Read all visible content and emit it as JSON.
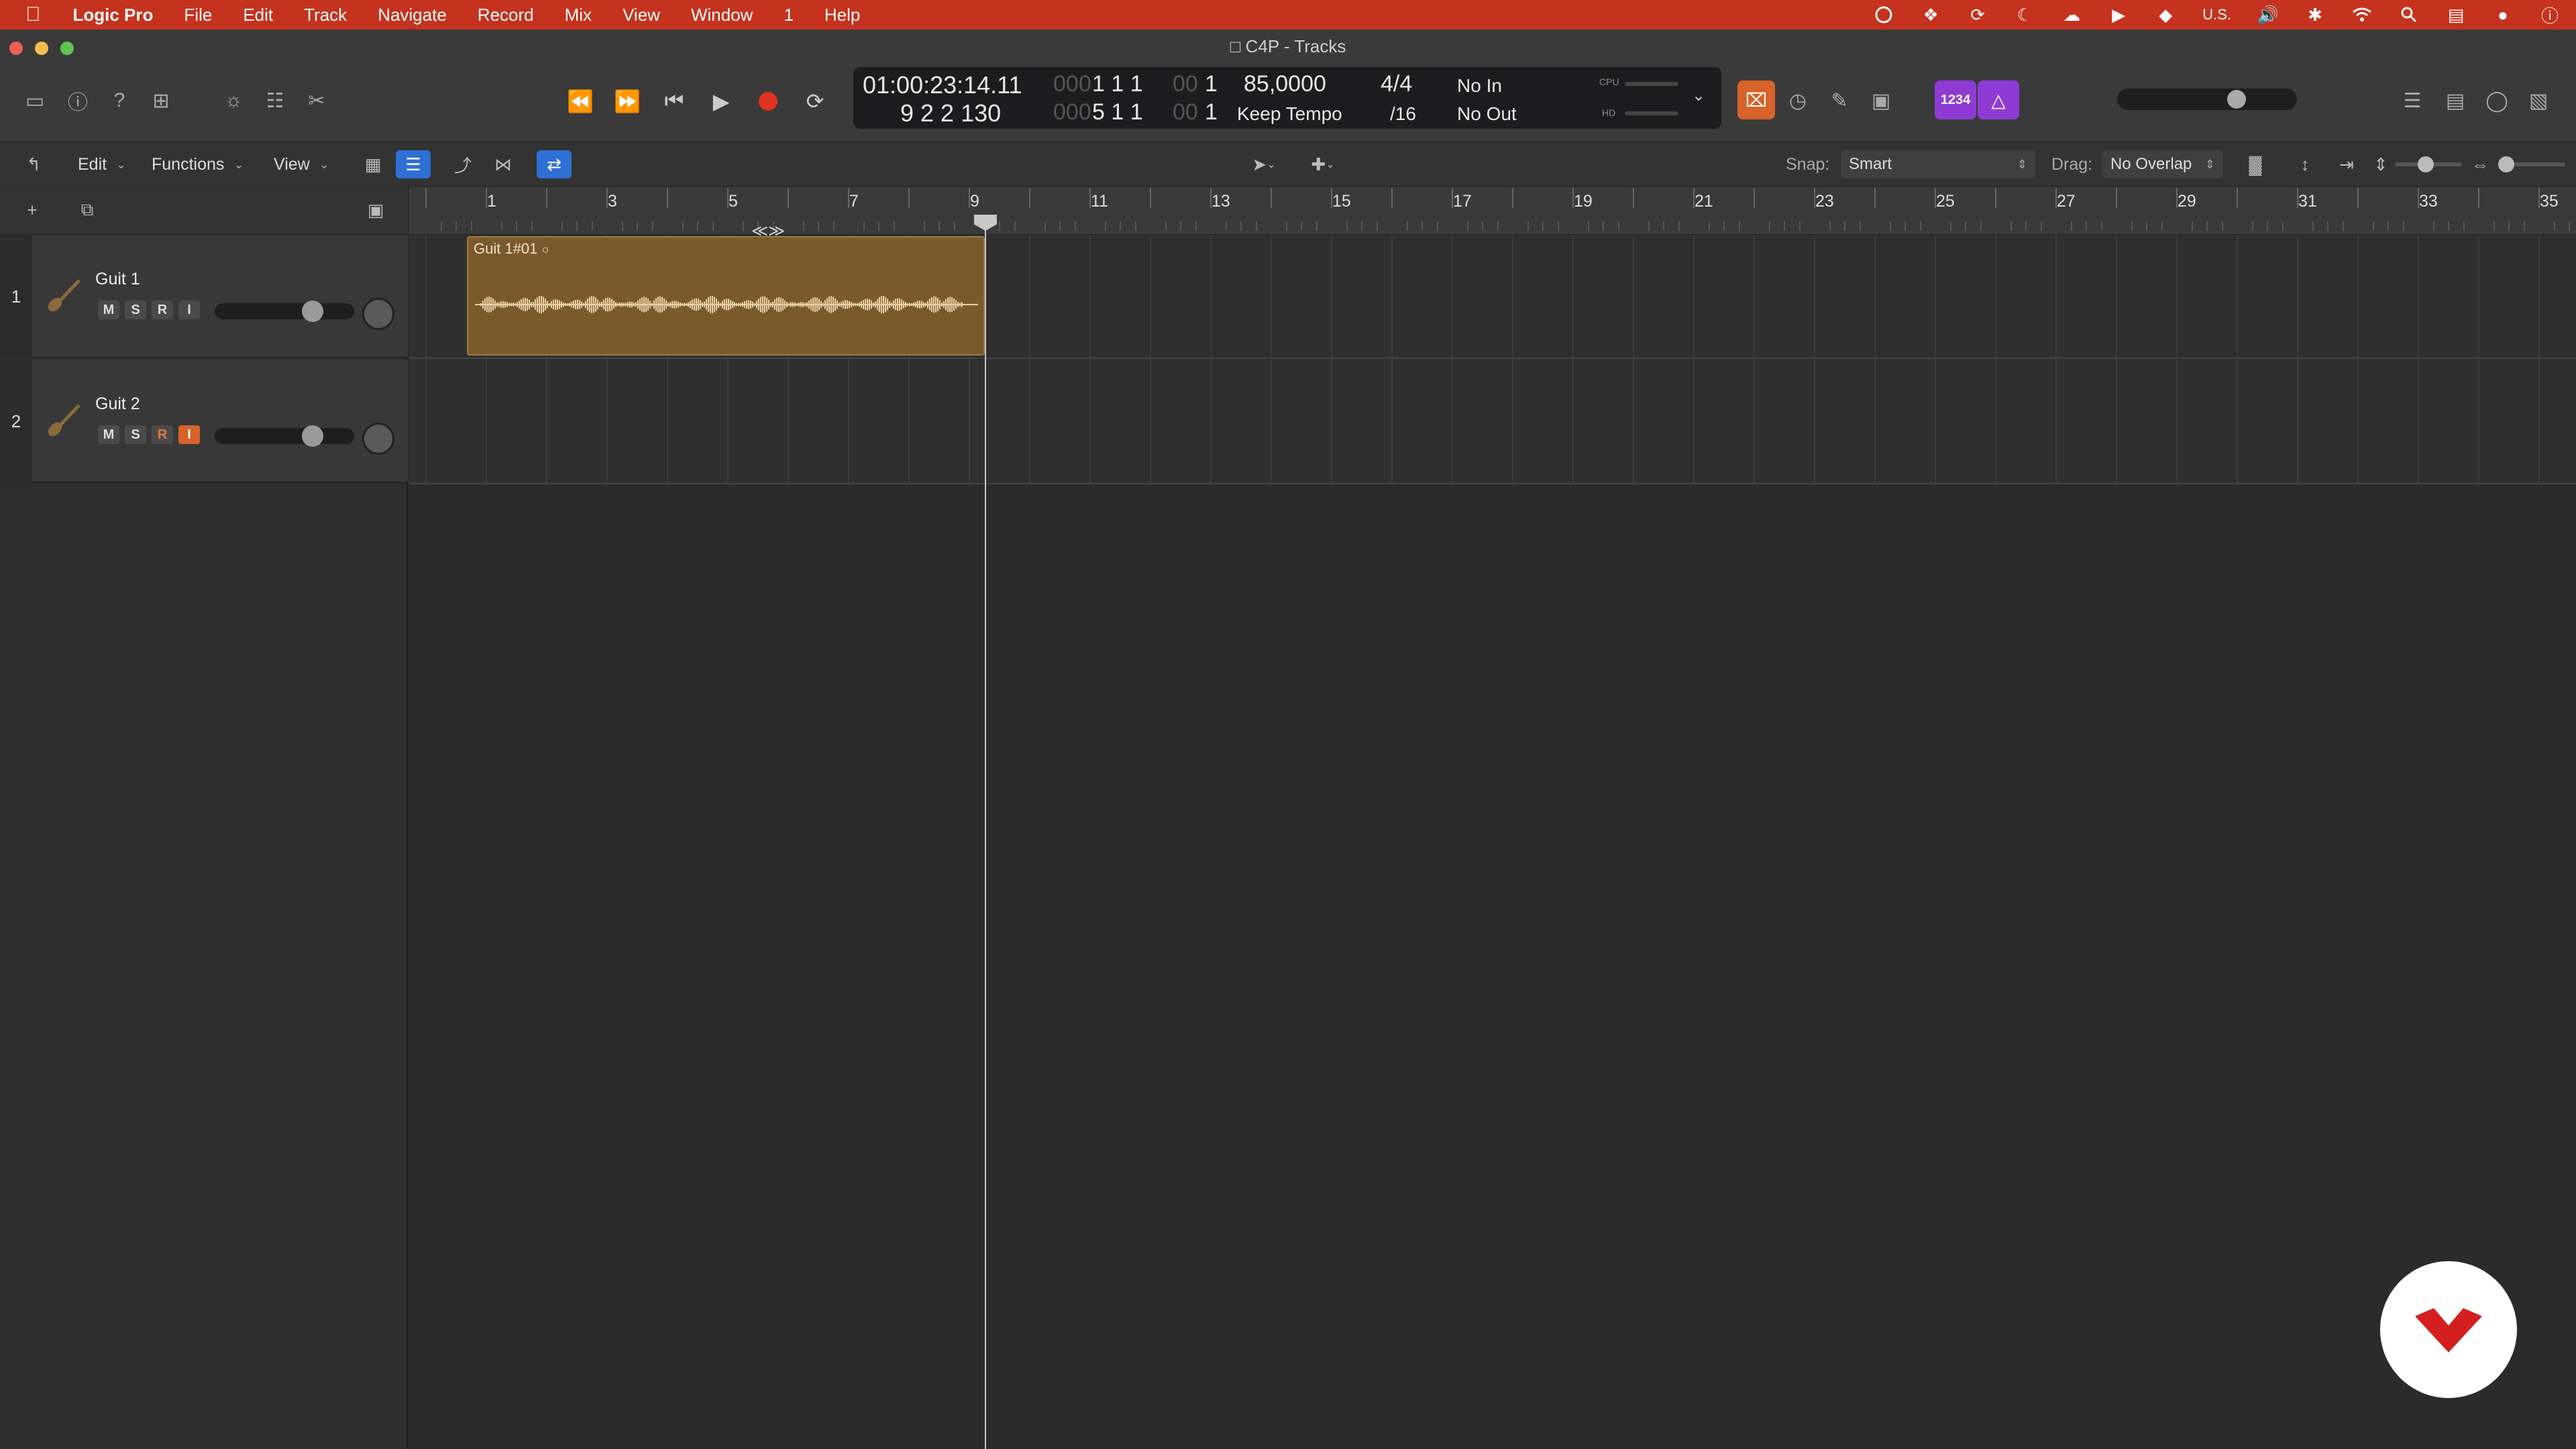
{
  "menubar": {
    "app_name": "Logic Pro",
    "items": [
      "File",
      "Edit",
      "Track",
      "Navigate",
      "Record",
      "Mix",
      "View",
      "Window",
      "1",
      "Help"
    ],
    "input_source": "U.S."
  },
  "window": {
    "title": "C4P - Tracks"
  },
  "lcd": {
    "time": "01:00:23:14.11",
    "position_bars": "9  2  2  130",
    "position_dim_top": "000",
    "position_top": "1  1  1",
    "position_top_dim2": "00",
    "position_top_tail": "1",
    "locator_dim": "000",
    "locator": "5  1  1",
    "locator_dim2": "00",
    "locator_tail": "1",
    "tempo": "85,0000",
    "tempo_mode": "Keep Tempo",
    "signature": "4/4",
    "division": "/16",
    "in": "No In",
    "out": "No Out",
    "cpu_label": "CPU",
    "hd_label": "HD"
  },
  "toolbar2": {
    "edit": "Edit",
    "functions": "Functions",
    "view": "View",
    "snap_label": "Snap:",
    "snap_value": "Smart",
    "drag_label": "Drag:",
    "drag_value": "No Overlap"
  },
  "chips": {
    "count_in": "1234"
  },
  "ruler": {
    "labels": [
      "1",
      "3",
      "5",
      "7",
      "9",
      "11",
      "13",
      "15",
      "17",
      "19",
      "21",
      "23",
      "25",
      "27",
      "29",
      "31",
      "33",
      "35"
    ]
  },
  "tracks": [
    {
      "number": "1",
      "name": "Guit 1",
      "m": "M",
      "s": "S",
      "r": "R",
      "i": "I",
      "volume": 0.74
    },
    {
      "number": "2",
      "name": "Guit 2",
      "m": "M",
      "s": "S",
      "r": "R",
      "i": "I",
      "volume": 0.74
    }
  ],
  "region": {
    "name": "Guit 1#01"
  },
  "colors": {
    "menubar": "#c5321e",
    "region": "#7a5a2d",
    "record": "#e0321e",
    "accent_blue": "#2f6fd6",
    "accent_purple": "#8e3bd6"
  }
}
